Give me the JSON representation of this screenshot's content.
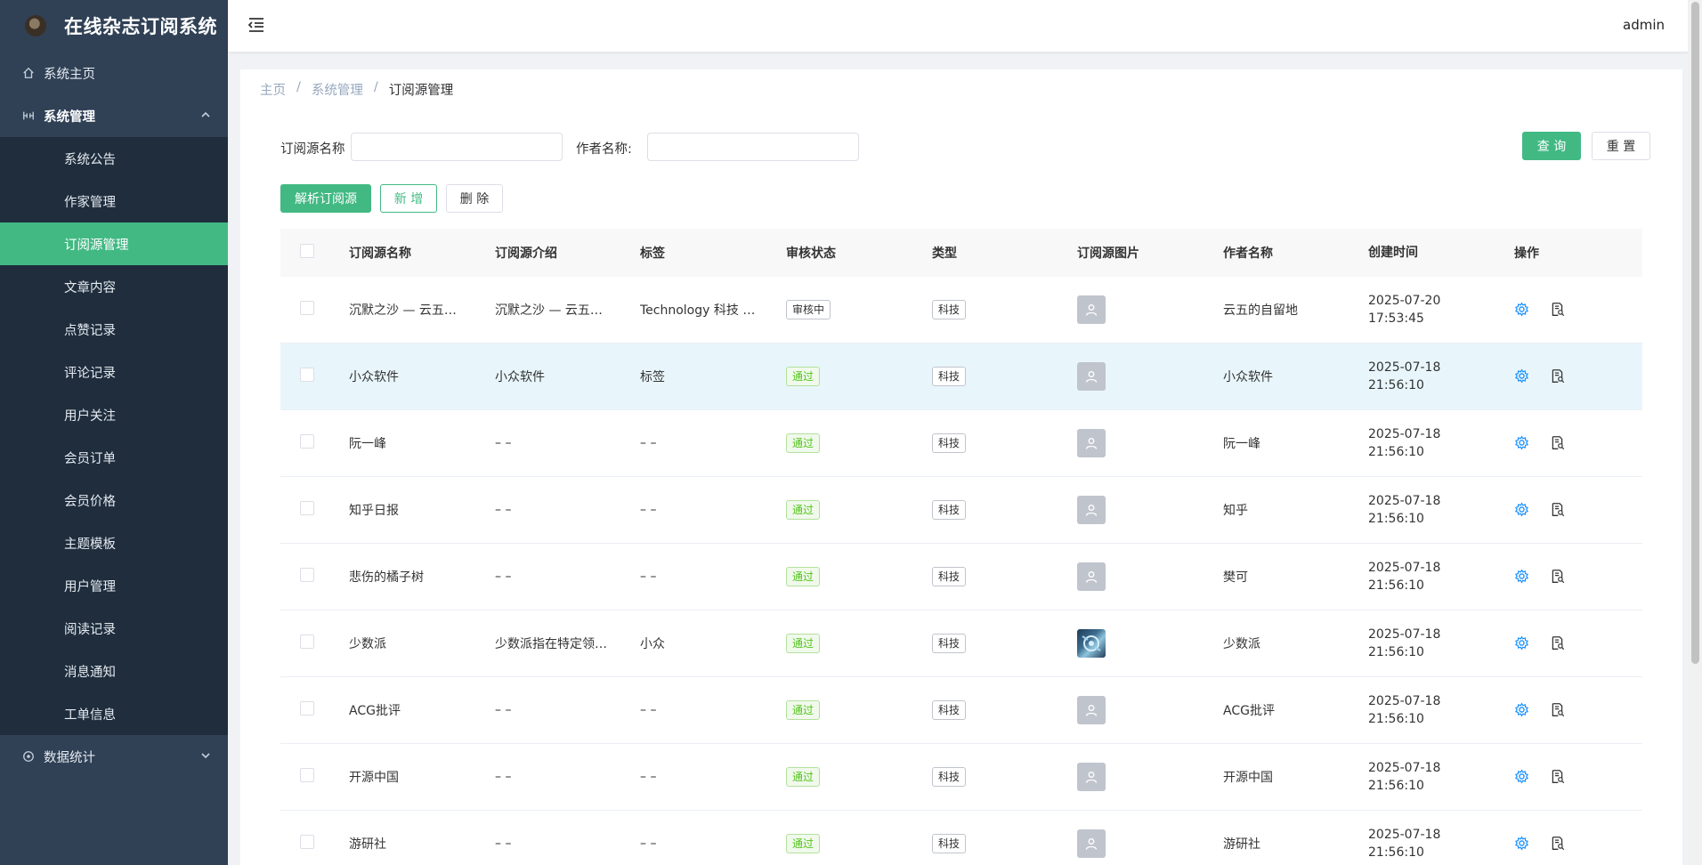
{
  "app": {
    "title": "在线杂志订阅系统",
    "user": "admin"
  },
  "sidebar": {
    "home": "系统主页",
    "system_group": "系统管理",
    "items": [
      "系统公告",
      "作家管理",
      "订阅源管理",
      "文章内容",
      "点赞记录",
      "评论记录",
      "用户关注",
      "会员订单",
      "会员价格",
      "主题模板",
      "用户管理",
      "阅读记录",
      "消息通知",
      "工单信息"
    ],
    "active_index": 2,
    "stats_group": "数据统计"
  },
  "breadcrumb": [
    "主页",
    "系统管理",
    "订阅源管理"
  ],
  "search": {
    "source_label": "订阅源名称",
    "source_value": "",
    "author_label": "作者名称:",
    "author_value": "",
    "query_button": "查 询",
    "reset_button": "重 置"
  },
  "toolbar": {
    "parse_button": "解析订阅源",
    "add_button": "新 增",
    "delete_button": "删 除"
  },
  "table": {
    "columns": [
      "订阅源名称",
      "订阅源介绍",
      "标签",
      "审核状态",
      "类型",
      "订阅源图片",
      "作者名称",
      "创建时间",
      "操作"
    ],
    "rows": [
      {
        "name": "沉默之沙 — 云五…",
        "intro": "沉默之沙 — 云五…",
        "tags": "Technology 科技 …",
        "status": "审核中",
        "status_kind": "pending",
        "type": "科技",
        "has_image": false,
        "author": "云五的自留地",
        "date": "2025-07-20",
        "time": "17:53:45"
      },
      {
        "name": "小众软件",
        "intro": "小众软件",
        "tags": "标签",
        "status": "通过",
        "status_kind": "pass",
        "type": "科技",
        "has_image": false,
        "author": "小众软件",
        "date": "2025-07-18",
        "time": "21:56:10"
      },
      {
        "name": "阮一峰",
        "intro": "– –",
        "tags": "– –",
        "status": "通过",
        "status_kind": "pass",
        "type": "科技",
        "has_image": false,
        "author": "阮一峰",
        "date": "2025-07-18",
        "time": "21:56:10"
      },
      {
        "name": "知乎日报",
        "intro": "– –",
        "tags": "– –",
        "status": "通过",
        "status_kind": "pass",
        "type": "科技",
        "has_image": false,
        "author": "知乎",
        "date": "2025-07-18",
        "time": "21:56:10"
      },
      {
        "name": "悲伤的橘子树",
        "intro": "– –",
        "tags": "– –",
        "status": "通过",
        "status_kind": "pass",
        "type": "科技",
        "has_image": false,
        "author": "樊可",
        "date": "2025-07-18",
        "time": "21:56:10"
      },
      {
        "name": "少数派",
        "intro": "少数派指在特定领…",
        "tags": "小众",
        "status": "通过",
        "status_kind": "pass",
        "type": "科技",
        "has_image": true,
        "author": "少数派",
        "date": "2025-07-18",
        "time": "21:56:10"
      },
      {
        "name": "ACG批评",
        "intro": "– –",
        "tags": "– –",
        "status": "通过",
        "status_kind": "pass",
        "type": "科技",
        "has_image": false,
        "author": "ACG批评",
        "date": "2025-07-18",
        "time": "21:56:10"
      },
      {
        "name": "开源中国",
        "intro": "– –",
        "tags": "– –",
        "status": "通过",
        "status_kind": "pass",
        "type": "科技",
        "has_image": false,
        "author": "开源中国",
        "date": "2025-07-18",
        "time": "21:56:10"
      },
      {
        "name": "游研社",
        "intro": "– –",
        "tags": "– –",
        "status": "通过",
        "status_kind": "pass",
        "type": "科技",
        "has_image": false,
        "author": "游研社",
        "date": "2025-07-18",
        "time": "21:56:10"
      }
    ],
    "hover_row": 1
  },
  "colors": {
    "accent": "#42b983",
    "sidebar_bg": "#304156",
    "submenu_bg": "#1f2d3d",
    "hover_row_bg": "#e8f6fc",
    "edit_icon": "#1890ff"
  },
  "icons": {
    "home": "home-icon",
    "system": "system-settings-icon",
    "stats": "stats-icon",
    "menu_toggle": "menu-fold-icon",
    "row_edit": "gear-icon",
    "row_detail": "document-search-icon",
    "placeholder_image": "user-placeholder-icon"
  }
}
